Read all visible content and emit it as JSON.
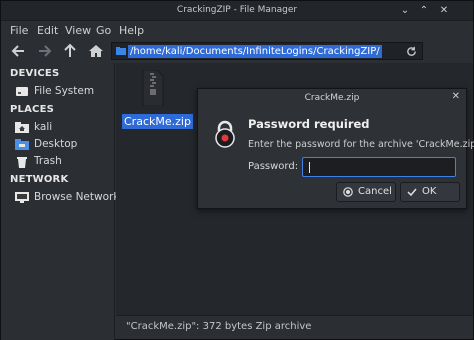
{
  "window": {
    "title": "CrackingZIP - File Manager",
    "minimize_glyph": "⌄",
    "maximize_glyph": "⌃",
    "close_glyph": "✕"
  },
  "menu": [
    "File",
    "Edit",
    "View",
    "Go",
    "Help"
  ],
  "toolbar": {
    "path": "/home/kali/Documents/InfiniteLogins/CrackingZIP/",
    "icons": [
      "back-arrow-icon",
      "forward-arrow-icon",
      "up-arrow-icon",
      "home-icon",
      "folder-icon",
      "reload-icon"
    ]
  },
  "sidebar": {
    "devices_heading": "DEVICES",
    "devices": [
      {
        "label": "File System",
        "icon": "drive-icon"
      }
    ],
    "places_heading": "PLACES",
    "places": [
      {
        "label": "kali",
        "icon": "home-folder-icon"
      },
      {
        "label": "Desktop",
        "icon": "desktop-folder-icon"
      },
      {
        "label": "Trash",
        "icon": "trash-icon"
      }
    ],
    "network_heading": "NETWORK",
    "network": [
      {
        "label": "Browse Network",
        "icon": "network-icon"
      }
    ]
  },
  "files": [
    {
      "name": "CrackMe.zip",
      "icon": "zip-archive-icon",
      "selected": true
    }
  ],
  "status": "\"CrackMe.zip\": 372 bytes Zip archive",
  "dialog": {
    "title": "CrackMe.zip",
    "close_glyph": "✕",
    "heading": "Password required",
    "message": "Enter the password for the archive 'CrackMe.zip'.",
    "password_label": "Password:",
    "password_value": "",
    "cancel_label": "Cancel",
    "ok_label": "OK"
  },
  "colors": {
    "selection": "#2f6bd6",
    "focus_border": "#3f82e6",
    "lock_accent": "#e03a3a"
  }
}
